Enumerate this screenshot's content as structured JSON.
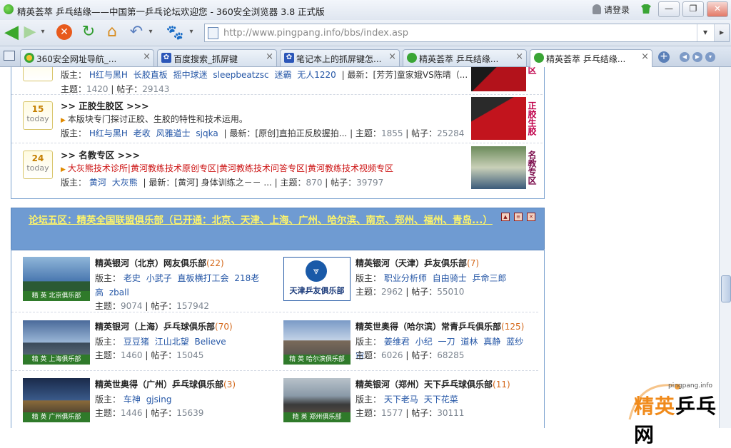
{
  "window": {
    "title": "精英荟萃 乒乓结缘——中国第一乒乓论坛欢迎您 - 360安全浏览器 3.8 正式版",
    "login": "请登录",
    "buttons": {
      "minimize": "—",
      "restore": "❐",
      "close": "✕"
    }
  },
  "navbar": {
    "back": "◀",
    "forward": "▶",
    "dropdown": "▾",
    "stop": "✕",
    "refresh": "↻",
    "home": "⌂",
    "undo": "↶",
    "paw": "🐾",
    "url": "http://www.pingpang.info/bbs/index.asp",
    "url_dropdown": "▾",
    "url_go": "▸"
  },
  "tabs": [
    {
      "label": "360安全网址导航_...",
      "icon": "360-logo-icon",
      "close": "×"
    },
    {
      "label": "百度搜索_抓屏键",
      "icon": "baidu-paw-icon",
      "close": "×"
    },
    {
      "label": "笔记本上的抓屏键怎...",
      "icon": "baidu-paw-icon",
      "close": "×"
    },
    {
      "label": "精英荟萃 乒乓结缘...",
      "icon": "pingpang-icon",
      "close": "×"
    },
    {
      "label": "精英荟萃 乒乓结缘...",
      "icon": "pingpang-icon",
      "close": "×",
      "active": true
    }
  ],
  "tab_controls": {
    "add": "+",
    "prev": "◀",
    "next": "▶",
    "list": "▾"
  },
  "boards": [
    {
      "date": "",
      "today": "today",
      "title": "",
      "desc": "",
      "mods": [
        "H红与黑H",
        "长胶直板",
        "摇中球迷",
        "sleepbeatzsc",
        "迷霸",
        "无人1220"
      ],
      "latest_label": "最新：",
      "latest": "[芳芳]童家娥VS陈晴（...",
      "topics_label": "主题：",
      "topics": "1420",
      "posts_label": "帖子：",
      "posts": "29143",
      "side_text": "区"
    },
    {
      "date": "15",
      "today": "today",
      "title": ">> 正胶生胶区  >>>",
      "desc": "本版块专门探讨正胶、生胶的特性和技术运用。",
      "mods_label": "版主：",
      "mods": [
        "H红与黑H",
        "老收",
        "风雅道士",
        "sjqka"
      ],
      "latest_label": "最新：",
      "latest": "[原创]直拍正反胶握拍...",
      "topics_label": "主题：",
      "topics": "1855",
      "posts_label": "帖子：",
      "posts": "25284",
      "side_text": "正胶生胶"
    },
    {
      "date": "24",
      "today": "today",
      "title": ">> 名教专区  >>>",
      "desc": "大灰熊技术诊所|黄河教练技术原创专区|黄河教练技术问答专区|黄河教练技术视频专区",
      "mods_label": "版主：",
      "mods": [
        "黄河",
        "大灰熊"
      ],
      "latest_label": "最新：",
      "latest": "[黄河] 身体训练之－－ ...",
      "topics_label": "主题：",
      "topics": "870",
      "posts_label": "帖子：",
      "posts": "39797",
      "side_text": "名教专区"
    }
  ],
  "section5": {
    "title": "论坛五区：精英全国联盟俱乐部（已开通：北京、天津、上海、广州、哈尔滨、南京、郑州、福州、青岛...）",
    "buttons": [
      "▲",
      "≡",
      "✕"
    ]
  },
  "clubs": [
    {
      "name": "精英银河（北京）网友俱乐部",
      "count": "(22)",
      "mods_label": "版主：",
      "mods": [
        "老史",
        "小武子",
        "直板横打工会",
        "218老高",
        "zball"
      ],
      "topics_label": "主题：",
      "topics": "9074",
      "posts_label": "帖子：",
      "posts": "157942",
      "img_label": "精 英 北京俱乐部"
    },
    {
      "name": "精英银河（天津）乒友俱乐部",
      "count": "(7)",
      "mods_label": "版主：",
      "mods": [
        "职业分析师",
        "自由骑士",
        "乒命三郎"
      ],
      "topics_label": "主题：",
      "topics": "2962",
      "posts_label": "帖子：",
      "posts": "55010",
      "img_label": "天津乒友俱乐部"
    },
    {
      "name": "精英银河（上海）乒乓球俱乐部",
      "count": "(70)",
      "mods_label": "版主：",
      "mods": [
        "豆豆猪",
        "江山北望",
        "Believe"
      ],
      "topics_label": "主题：",
      "topics": "1460",
      "posts_label": "帖子：",
      "posts": "15045",
      "img_label": "精 英 上海俱乐部"
    },
    {
      "name": "精英世奥得（哈尔滨）常青乒乓俱乐部",
      "count": "(125)",
      "mods_label": "版主：",
      "mods": [
        "姜维君",
        "小纪",
        "一刀",
        "道林",
        "真静",
        "蓝纱帘"
      ],
      "topics_label": "主题：",
      "topics": "6026",
      "posts_label": "帖子：",
      "posts": "68285",
      "img_label": "精 英 哈尔滨俱乐部"
    },
    {
      "name": "精英世奥得（广州）乒乓球俱乐部",
      "count": "(3)",
      "mods_label": "版主：",
      "mods": [
        "车神",
        "gjsing"
      ],
      "topics_label": "主题：",
      "topics": "1446",
      "posts_label": "帖子：",
      "posts": "15639",
      "img_label": "精 英 广州俱乐部"
    },
    {
      "name": "精英银河（郑州）天下乒乓球俱乐部",
      "count": "(11)",
      "mods_label": "版主：",
      "mods": [
        "天下老马",
        "天下花菜"
      ],
      "topics_label": "主题：",
      "topics": "1577",
      "posts_label": "帖子：",
      "posts": "30111",
      "img_label": "精 英 郑州俱乐部"
    }
  ],
  "watermark": {
    "url": "pingpang.info",
    "brand_a": "精英",
    "brand_b": "乒乓网"
  },
  "colors": {
    "section_bg": "#6f9bd2",
    "section_title": "#fff56a",
    "moderator": "#2456a6",
    "count": "#d4681a"
  }
}
